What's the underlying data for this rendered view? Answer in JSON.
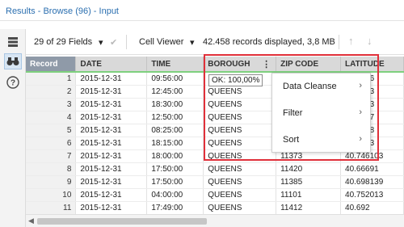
{
  "window": {
    "title": "Results - Browse (96) - Input"
  },
  "toolbar": {
    "fields_label": "29 of 29 Fields",
    "viewer_label": "Cell Viewer",
    "records_info": "42.458 records displayed, 3,8 MB"
  },
  "table": {
    "headers": [
      "Record",
      "DATE",
      "TIME",
      "BOROUGH",
      "ZIP CODE",
      "LATITUDE"
    ],
    "rows": [
      [
        "1",
        "2015-12-31",
        "09:56:00",
        "",
        "",
        "40.6976"
      ],
      [
        "2",
        "2015-12-31",
        "12:45:00",
        "QUEENS",
        "",
        "40.6963"
      ],
      [
        "3",
        "2015-12-31",
        "18:30:00",
        "QUEENS",
        "",
        "40.7963"
      ],
      [
        "4",
        "2015-12-31",
        "12:50:00",
        "QUEENS",
        "",
        "40.7707"
      ],
      [
        "5",
        "2015-12-31",
        "08:25:00",
        "QUEENS",
        "",
        "40.6568"
      ],
      [
        "6",
        "2015-12-31",
        "18:15:00",
        "QUEENS",
        "",
        "40.7863"
      ],
      [
        "7",
        "2015-12-31",
        "18:00:00",
        "QUEENS",
        "11373",
        "40.746103"
      ],
      [
        "8",
        "2015-12-31",
        "17:50:00",
        "QUEENS",
        "11420",
        "40.66691"
      ],
      [
        "9",
        "2015-12-31",
        "17:50:00",
        "QUEENS",
        "11385",
        "40.698139"
      ],
      [
        "10",
        "2015-12-31",
        "04:00:00",
        "QUEENS",
        "11101",
        "40.752013"
      ],
      [
        "11",
        "2015-12-31",
        "17:49:00",
        "QUEENS",
        "11412",
        "40.692"
      ]
    ]
  },
  "tooltip": {
    "text": "OK: 100,00%"
  },
  "context_menu": {
    "items": [
      {
        "label": "Data Cleanse",
        "chevron": "›"
      },
      {
        "label": "Filter",
        "chevron": "›"
      },
      {
        "label": "Sort",
        "chevron": "›"
      }
    ]
  },
  "icons": {
    "dropdown": "▾",
    "apply": "✔",
    "up": "↑",
    "down": "↓",
    "kebab": "⋮",
    "scroll_left": "◀"
  },
  "colors": {
    "title_blue": "#2b6fb0",
    "highlight_red": "#e0303a",
    "status_green": "#7ed07e",
    "record_header": "#8f9aa8"
  }
}
